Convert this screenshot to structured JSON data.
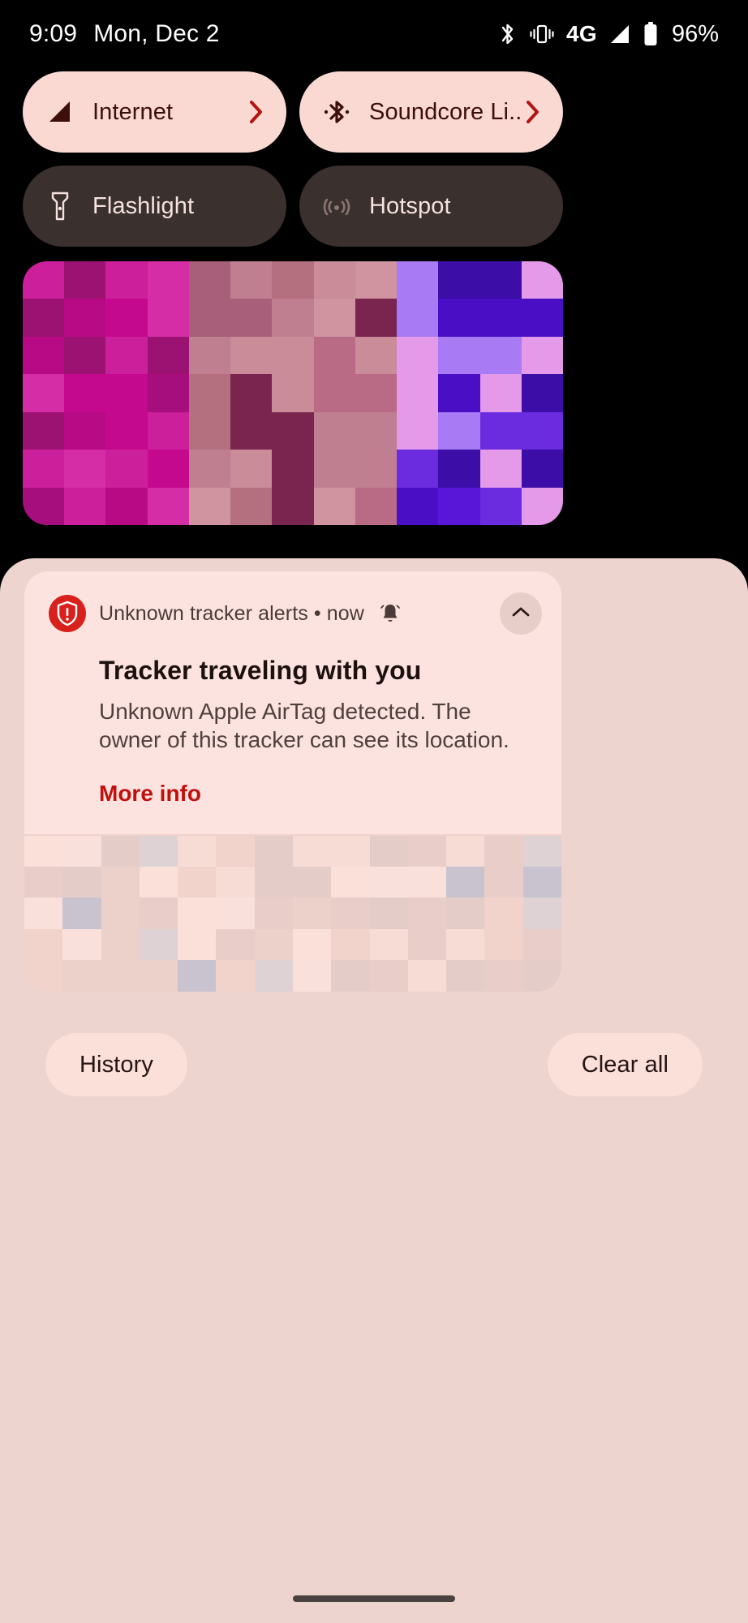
{
  "status_bar": {
    "time": "9:09",
    "date": "Mon, Dec 2",
    "network_type": "4G",
    "battery_percent": "96%",
    "icons": [
      "bluetooth-icon",
      "vibrate-icon",
      "signal-icon",
      "battery-icon"
    ]
  },
  "quick_settings": {
    "tiles": [
      {
        "label": "Internet",
        "icon": "signal-cellular-icon",
        "state": "active",
        "has_chevron": true
      },
      {
        "label": "Soundcore Li..",
        "icon": "bluetooth-icon",
        "state": "active",
        "has_chevron": true
      },
      {
        "label": "Flashlight",
        "icon": "flashlight-icon",
        "state": "inactive",
        "has_chevron": false
      },
      {
        "label": "Hotspot",
        "icon": "hotspot-icon",
        "state": "inactive",
        "has_chevron": false
      }
    ]
  },
  "media_player": {
    "obscured": true,
    "description": "Media player card, content pixelated"
  },
  "notification": {
    "app_name": "Unknown tracker alerts",
    "timestamp": "now",
    "meta_line": "Unknown tracker alerts  •  now",
    "title": "Tracker traveling with you",
    "body": "Unknown Apple AirTag detected. The owner of this tracker can see its location.",
    "action_label": "More info",
    "app_icon": "shield-alert-icon",
    "alert_icon": "bell-ringing-icon",
    "collapse_icon": "chevron-up-icon"
  },
  "secondary_notification": {
    "obscured": true,
    "description": "Second notification, content pixelated"
  },
  "shade_footer": {
    "history_label": "History",
    "clear_all_label": "Clear all"
  },
  "colors": {
    "accent_red": "#c0100d",
    "app_icon_red": "#d8201c",
    "tile_active_bg": "#fbd9d3",
    "tile_inactive_bg": "#3a302e",
    "shade_bg": "#eed4ce",
    "notification_bg": "#fde3df",
    "background": "#000000"
  }
}
